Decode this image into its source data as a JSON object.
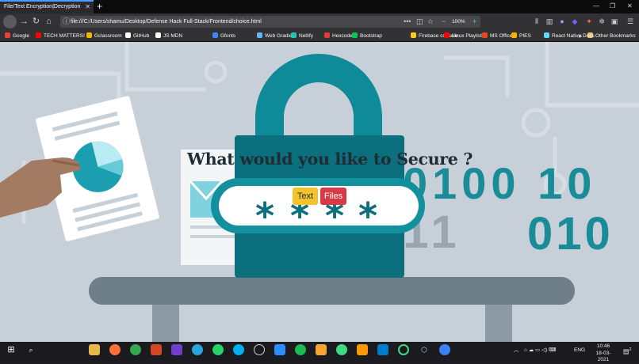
{
  "browser": {
    "tab_title": "File/Text Encryption|Decryption",
    "url": "file:///C:/Users/shamu/Desktop/Defense Hack Full-Stack/Frontend/choice.html",
    "zoom": "100%",
    "bookmarks": [
      {
        "label": "Google",
        "color": "#ea4335"
      },
      {
        "label": "TECH MATTERS!",
        "color": "#ff0000"
      },
      {
        "label": "Gclassroom",
        "color": "#f4b400"
      },
      {
        "label": "GitHub",
        "color": "#ffffff"
      },
      {
        "label": "JS MDN",
        "color": "#ffffff"
      },
      {
        "label": "Gfonts",
        "color": "#4285f4"
      },
      {
        "label": "Web Gradient",
        "color": "#64b5f6"
      },
      {
        "label": "Netlify",
        "color": "#20c6b7"
      },
      {
        "label": "Hexcode",
        "color": "#e53935"
      },
      {
        "label": "Bootstrap",
        "color": "#00c853"
      },
      {
        "label": "Firebase console",
        "color": "#ffca28"
      },
      {
        "label": "Linux Playlist",
        "color": "#ff0000"
      },
      {
        "label": "MS Office",
        "color": "#e64a19"
      },
      {
        "label": "PIES",
        "color": "#ffb300"
      },
      {
        "label": "React Native Docs",
        "color": "#61dafb"
      }
    ],
    "other_bookmarks": "Other Bookmarks"
  },
  "page": {
    "heading": "What would you like to Secure ?",
    "buttons": {
      "text": "Text",
      "files": "Files"
    },
    "colors": {
      "teal": "#0f8a99",
      "dark_teal": "#0b6f7d",
      "yellow": "#f4c22b",
      "red": "#d83a46",
      "background": "#c7d0d8"
    }
  },
  "taskbar": {
    "language": "ENG",
    "time": "10:46",
    "date": "18-03-2021",
    "notification_count": "2"
  }
}
